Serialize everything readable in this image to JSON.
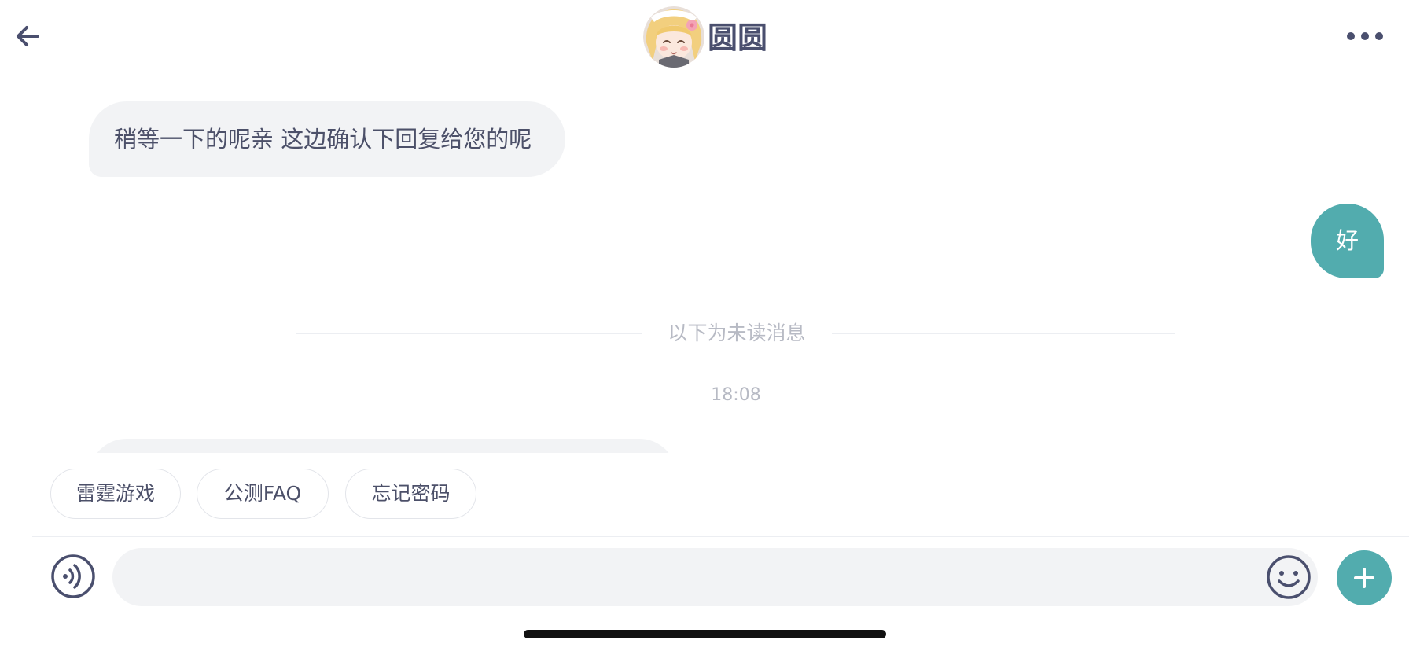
{
  "header": {
    "contact_name": "圆圆",
    "back_icon": "arrow-left-icon",
    "more_icon": "more-horizontal-icon"
  },
  "messages": {
    "incoming_text": "稍等一下的呢亲 这边确认下回复给您的呢",
    "outgoing_text": "好",
    "unread_divider": "以下为未读消息",
    "timestamp": "18:08"
  },
  "quick_replies": [
    "雷霆游戏",
    "公测FAQ",
    "忘记密码"
  ],
  "input_bar": {
    "placeholder": "",
    "voice_icon": "voice-icon",
    "emoji_icon": "emoji-icon",
    "plus_icon": "plus-icon"
  },
  "colors": {
    "accent": "#52acae",
    "bubble_incoming": "#f2f3f5",
    "text_primary": "#4c5069",
    "text_muted": "#b7bac4"
  }
}
